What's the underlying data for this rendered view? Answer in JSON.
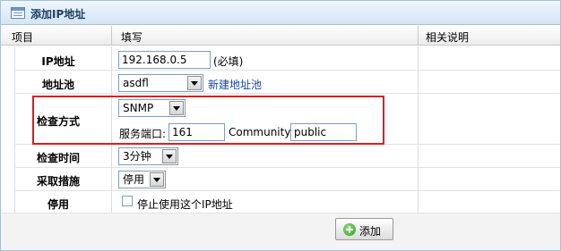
{
  "title": "添加IP地址",
  "columns": {
    "item": "项目",
    "fill": "填写",
    "notes": "相关说明"
  },
  "ip": {
    "label": "IP地址",
    "value": "192.168.0.5",
    "required_note": "(必填)"
  },
  "pool": {
    "label": "地址池",
    "selected": "asdfl",
    "new_link": "新建地址池"
  },
  "check_method": {
    "label": "检查方式",
    "selected": "SNMP",
    "port_label": "服务端口:",
    "port_value": "161",
    "community_label": "Community:",
    "community_value": "public"
  },
  "check_time": {
    "label": "检查时间",
    "selected": "3分钟"
  },
  "action": {
    "label": "采取措施",
    "selected": "停用"
  },
  "disable": {
    "label": "停用",
    "checkbox_label": "停止使用这个IP地址",
    "checked": false
  },
  "buttons": {
    "add": "添加"
  },
  "colors": {
    "highlight_border": "#e11b1b",
    "link": "#1646a5",
    "title": "#1d3f66"
  }
}
